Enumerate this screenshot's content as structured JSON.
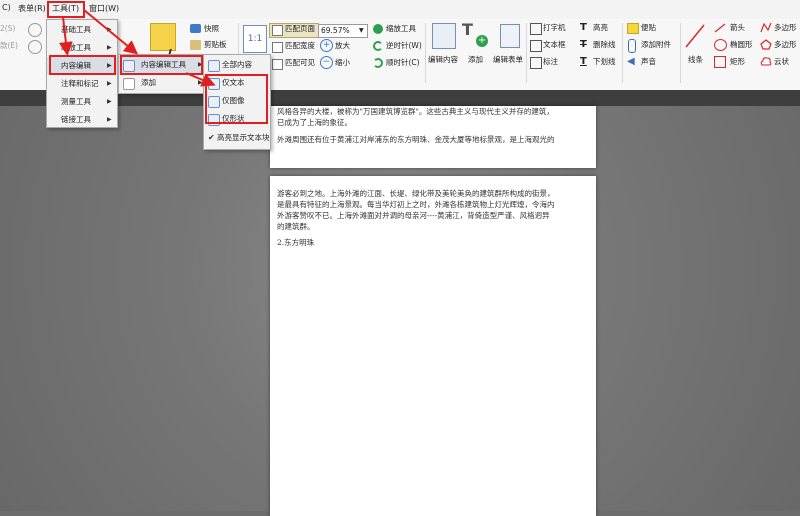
{
  "menubar": {
    "items": [
      "C)",
      "表单(R)",
      "工具(T)",
      "窗口(W)"
    ]
  },
  "ribbon": {
    "groups": {
      "snapshot": "快照",
      "clipboard": "剪贴板",
      "zoom_fit_page": "匹配页面",
      "zoom_fit_width": "匹配宽度",
      "zoom_fit_visible": "匹配可见",
      "zoom_value": "69.57%",
      "zoom_in": "放大",
      "zoom_out": "缩小",
      "zoom_tools": "缩放工具",
      "rotate_ccw": "逆时针(W)",
      "rotate_cw": "顺时针(C)",
      "edit_content": "编辑内容",
      "add": "添加",
      "edit_form": "编辑表单",
      "typewriter": "打字机",
      "textbox": "文本框",
      "callout": "标注",
      "highlight": "高亮",
      "strikeout": "删除线",
      "underline": "下划线",
      "note": "便贴",
      "attach_file": "添加附件",
      "sound": "声音",
      "line": "线条",
      "arrow": "箭头",
      "ellipse": "椭圆形",
      "rectangle": "矩形",
      "polygon": "多边形",
      "polyline": "多边形",
      "cloud": "云状",
      "left_labels": [
        "2(S)",
        "款(E)"
      ]
    }
  },
  "tools_menu": {
    "items": [
      "基础工具",
      "缩放工具",
      "内容编辑",
      "注释和标记",
      "测量工具",
      "链接工具"
    ]
  },
  "content_edit_submenu": {
    "items": [
      "内容编辑工具",
      "添加"
    ]
  },
  "content_edit_tools_submenu": {
    "items": [
      "全部内容",
      "仅文本",
      "仅图像",
      "仅形状",
      "高亮显示文本块"
    ],
    "checked": "高亮显示文本块"
  },
  "document": {
    "page1_lines": [
      "风格各异的大楼，被称为\"万国建筑博览群\"。这些古典主义与现代主义并存的建筑，",
      "已成为了上海的象征。",
      "",
      "外滩周围还有位于黄浦江对岸浦东的东方明珠、金茂大厦等地标景观，是上海观光的"
    ],
    "page2_lines": [
      "游客必到之地。上海外滩的江面、长堤、绿化带及美轮美奂的建筑群所构成的街景，",
      "是最具有特征的上海景观。每当华灯初上之时，外滩各栋建筑物上灯光辉煌，令海内",
      "外游客赞叹不已。上海外滩面对并调的母亲河----黄浦江，背倚造型严谨、风格迥异",
      "的建筑群。",
      "",
      "2.东方明珠"
    ]
  },
  "colors": {
    "red_annotation": "#e02020",
    "menu_bg": "#f2f2f2",
    "workspace": "#6e6e6e",
    "highlight": "#e9e4c6"
  }
}
